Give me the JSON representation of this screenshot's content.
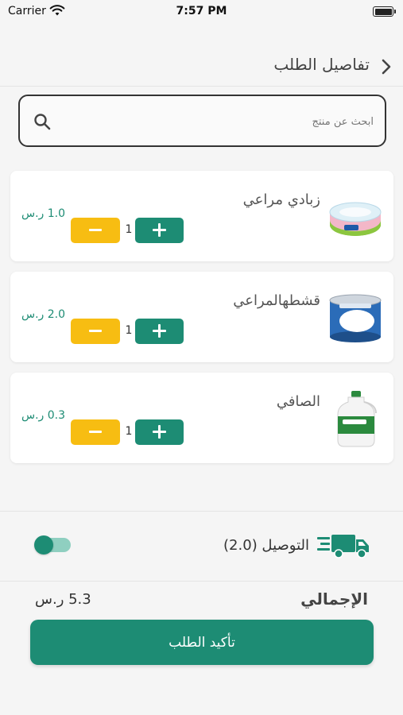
{
  "status_bar": {
    "carrier": "Carrier",
    "time": "7:57 PM"
  },
  "header": {
    "title": "تفاصيل الطلب"
  },
  "search": {
    "placeholder": "ابحث عن منتج",
    "value": ""
  },
  "items": [
    {
      "name": "زبادي مراعي",
      "price": "1.0 ر.س",
      "quantity": "1",
      "image": "yogurt-cup"
    },
    {
      "name": "قشطهالمراعي",
      "price": "2.0 ر.س",
      "quantity": "1",
      "image": "cream-can"
    },
    {
      "name": "الصافي",
      "price": "0.3 ر.س",
      "quantity": "1",
      "image": "laban-bottle"
    }
  ],
  "delivery": {
    "label": "التوصيل (2.0)",
    "enabled": false
  },
  "total": {
    "label": "الإجمالي",
    "value": "5.3 ر.س"
  },
  "confirm": {
    "label": "تأكيد الطلب"
  },
  "colors": {
    "accent": "#1d8c74",
    "minus": "#f7bd12",
    "background": "#f5f5f5"
  }
}
